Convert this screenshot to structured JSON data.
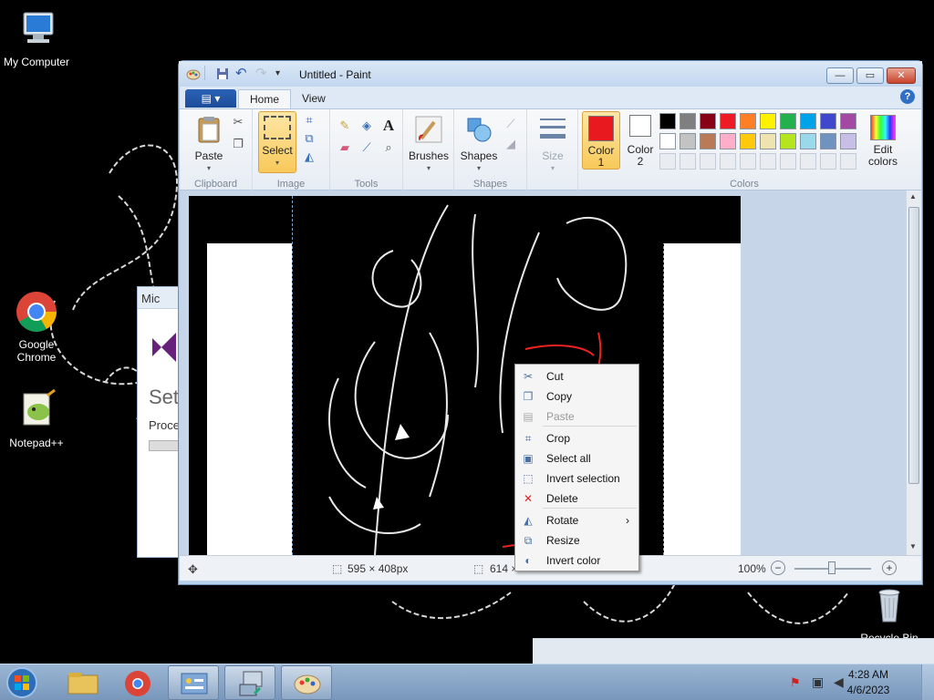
{
  "desktop": {
    "icons": [
      {
        "label": "My Computer"
      },
      {
        "label": "Google Chrome"
      },
      {
        "label": "Notepad++"
      },
      {
        "label": "Recycle Bin"
      }
    ],
    "bg_window": {
      "title_fragment": "Mic",
      "heading_fragment": "Set",
      "text_fragment": "Proce"
    }
  },
  "paint": {
    "title": "Untitled - Paint",
    "window_buttons": {
      "minimize": "—",
      "maximize": "▭",
      "close": "✕"
    },
    "file_tab": "▤ ▾",
    "tabs": [
      {
        "label": "Home"
      },
      {
        "label": "View"
      }
    ],
    "help": "?",
    "groups": {
      "clipboard": "Clipboard",
      "image": "Image",
      "tools": "Tools",
      "shapes": "Shapes",
      "colors": "Colors"
    },
    "buttons": {
      "paste": "Paste",
      "select": "Select",
      "brushes": "Brushes",
      "shapes": "Shapes",
      "size": "Size",
      "color1_line1": "Color",
      "color1_line2": "1",
      "color2_line1": "Color",
      "color2_line2": "2",
      "edit_colors_line1": "Edit",
      "edit_colors_line2": "colors"
    },
    "color1": "#e8191f",
    "color2": "#ffffff",
    "palette": [
      "#000000",
      "#7f7f7f",
      "#880015",
      "#ed1c24",
      "#ff7f27",
      "#fff200",
      "#22b14c",
      "#00a2e8",
      "#3f48cc",
      "#a349a4",
      "#ffffff",
      "#c3c3c3",
      "#b97a57",
      "#ffaec9",
      "#ffc90e",
      "#efe4b0",
      "#b5e61d",
      "#99d9ea",
      "#7092be",
      "#c8bfe7"
    ],
    "status": {
      "selection_size": "595 × 408px",
      "image_size": "614 ×",
      "zoom": "100%",
      "minus": "−",
      "plus": "+"
    }
  },
  "context_menu": {
    "items": [
      {
        "label": "Cut",
        "icon": "✂",
        "disabled": false
      },
      {
        "label": "Copy",
        "icon": "❐",
        "disabled": false
      },
      {
        "label": "Paste",
        "icon": "▤",
        "disabled": true
      },
      {
        "label": "Crop",
        "icon": "⌗",
        "disabled": false
      },
      {
        "label": "Select all",
        "icon": "▣",
        "disabled": false
      },
      {
        "label": "Invert selection",
        "icon": "⬚",
        "disabled": false
      },
      {
        "label": "Delete",
        "icon": "✕",
        "disabled": false
      },
      {
        "label": "Rotate",
        "icon": "◭",
        "disabled": false,
        "submenu": "›"
      },
      {
        "label": "Resize",
        "icon": "⧉",
        "disabled": false
      },
      {
        "label": "Invert color",
        "icon": "◐",
        "disabled": false
      }
    ]
  },
  "taskbar": {
    "time": "4:28 AM",
    "date": "4/6/2023"
  }
}
